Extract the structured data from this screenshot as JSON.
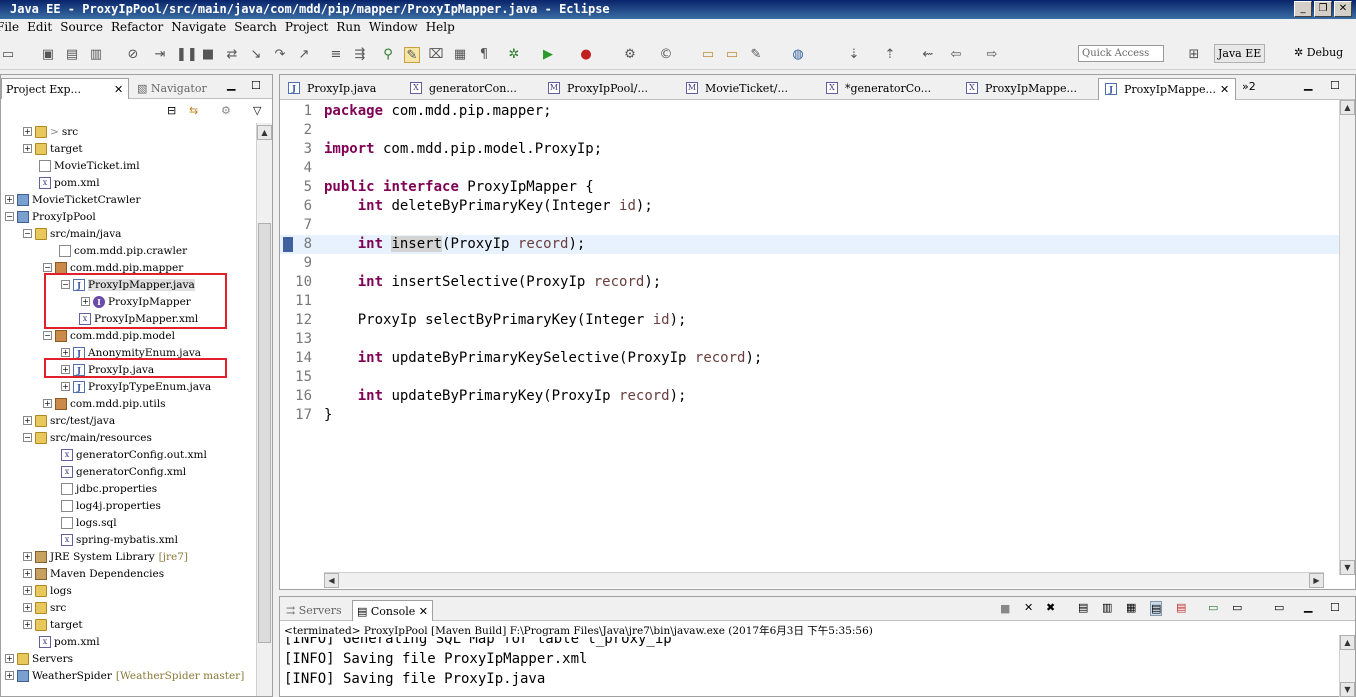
{
  "window": {
    "title": "Java EE - ProxyIpPool/src/main/java/com/mdd/pip/mapper/ProxyIpMapper.java - Eclipse"
  },
  "menu": [
    "File",
    "Edit",
    "Source",
    "Refactor",
    "Navigate",
    "Search",
    "Project",
    "Run",
    "Window",
    "Help"
  ],
  "toolbar": {
    "quick_access": "Quick Access",
    "perspective_javaee": "Java EE",
    "perspective_debug": "Debug"
  },
  "left_panel": {
    "tab_project_explorer": "Project Exp...",
    "tab_navigator": "Navigator",
    "tree": [
      {
        "label": "src",
        "icon": "folder"
      },
      {
        "label": "target",
        "icon": "folder"
      },
      {
        "label": "MovieTicket.iml",
        "icon": "file"
      },
      {
        "label": "pom.xml",
        "icon": "xml"
      },
      {
        "label": "MovieTicketCrawler",
        "icon": "project"
      },
      {
        "label": "ProxyIpPool",
        "icon": "project"
      },
      {
        "label": "src/main/java",
        "icon": "folder"
      },
      {
        "label": "com.mdd.pip.crawler",
        "icon": "package"
      },
      {
        "label": "com.mdd.pip.mapper",
        "icon": "package"
      },
      {
        "label": "ProxyIpMapper.java",
        "icon": "java"
      },
      {
        "label": "ProxyIpMapper",
        "icon": "interface"
      },
      {
        "label": "ProxyIpMapper.xml",
        "icon": "xml"
      },
      {
        "label": "com.mdd.pip.model",
        "icon": "package"
      },
      {
        "label": "AnonymityEnum.java",
        "icon": "java"
      },
      {
        "label": "ProxyIp.java",
        "icon": "java"
      },
      {
        "label": "ProxyIpTypeEnum.java",
        "icon": "java"
      },
      {
        "label": "com.mdd.pip.utils",
        "icon": "package"
      },
      {
        "label": "src/test/java",
        "icon": "folder"
      },
      {
        "label": "src/main/resources",
        "icon": "folder"
      },
      {
        "label": "generatorConfig.out.xml",
        "icon": "xml"
      },
      {
        "label": "generatorConfig.xml",
        "icon": "xml"
      },
      {
        "label": "jdbc.properties",
        "icon": "file"
      },
      {
        "label": "log4j.properties",
        "icon": "file"
      },
      {
        "label": "logs.sql",
        "icon": "file"
      },
      {
        "label": "spring-mybatis.xml",
        "icon": "xml"
      },
      {
        "label": "JRE System Library",
        "suffix": "[jre7]",
        "icon": "library"
      },
      {
        "label": "Maven Dependencies",
        "icon": "library"
      },
      {
        "label": "logs",
        "icon": "folder"
      },
      {
        "label": "src",
        "icon": "folder"
      },
      {
        "label": "target",
        "icon": "folder"
      },
      {
        "label": "pom.xml",
        "icon": "xml"
      },
      {
        "label": "Servers",
        "icon": "project"
      },
      {
        "label": "WeatherSpider",
        "suffix": "[WeatherSpider master]",
        "icon": "project"
      }
    ]
  },
  "editor": {
    "tabs": [
      "ProxyIp.java",
      "generatorCon...",
      "ProxyIpPool/...",
      "MovieTicket/...",
      "*generatorCo...",
      "ProxyIpMappe...",
      "ProxyIpMappe..."
    ],
    "overflow_tabs": "»2",
    "lines": [
      "package com.mdd.pip.mapper;",
      "",
      "import com.mdd.pip.model.ProxyIp;",
      "",
      "public interface ProxyIpMapper {",
      "    int deleteByPrimaryKey(Integer id);",
      "",
      "    int insert(ProxyIp record);",
      "",
      "    int insertSelective(ProxyIp record);",
      "",
      "    ProxyIp selectByPrimaryKey(Integer id);",
      "",
      "    int updateByPrimaryKeySelective(ProxyIp record);",
      "",
      "    int updateByPrimaryKey(ProxyIp record);",
      "}"
    ],
    "highlighted_line": 8
  },
  "console": {
    "tab_servers": "Servers",
    "tab_console": "Console",
    "status": "<terminated> ProxyIpPool [Maven Build] F:\\Program Files\\Java\\jre7\\bin\\javaw.exe (2017年6月3日 下午5:35:56)",
    "lines": [
      "[INFO] Generating SQL Map for table t_proxy_ip",
      "[INFO] Saving file ProxyIpMapper.xml",
      "[INFO] Saving file ProxyIp.java"
    ]
  }
}
